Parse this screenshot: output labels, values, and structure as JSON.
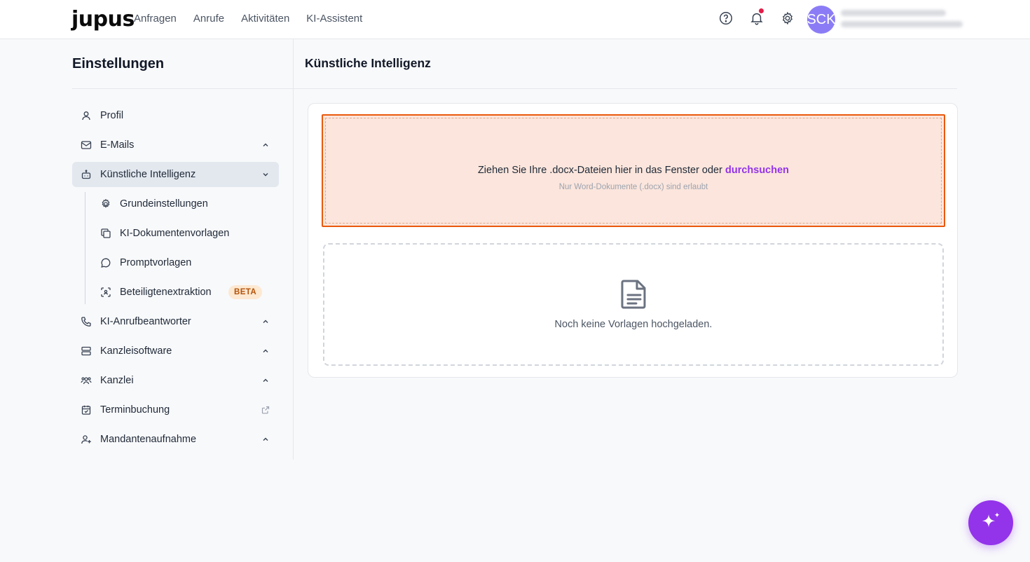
{
  "header": {
    "logo": "jupus",
    "nav": [
      "Anfragen",
      "Anrufe",
      "Aktivitäten",
      "KI-Assistent"
    ],
    "avatar_initials": "SCK"
  },
  "sidebar": {
    "title": "Einstellungen",
    "items": [
      {
        "label": "Profil",
        "icon": "user-icon"
      },
      {
        "label": "E-Mails",
        "icon": "mail-icon"
      },
      {
        "label": "Künstliche Intelligenz",
        "icon": "bot-icon",
        "active": true
      },
      {
        "label": "KI-Anrufbeantworter",
        "icon": "phone-icon"
      },
      {
        "label": "Kanzleisoftware",
        "icon": "server-icon"
      },
      {
        "label": "Kanzlei",
        "icon": "users-icon"
      },
      {
        "label": "Terminbuchung",
        "icon": "calendar-check-icon"
      },
      {
        "label": "Mandantenaufnahme",
        "icon": "user-plus-icon"
      }
    ],
    "subitems": [
      {
        "label": "Grundeinstellungen",
        "icon": "gear-icon"
      },
      {
        "label": "KI-Dokumentenvorlagen",
        "icon": "copy-icon"
      },
      {
        "label": "Promptvorlagen",
        "icon": "chat-icon"
      },
      {
        "label": "Beteiligtenextraktion",
        "icon": "scan-user-icon",
        "badge": "BETA"
      }
    ]
  },
  "main": {
    "title": "Künstliche Intelligenz",
    "dropzone": {
      "text": "Ziehen Sie Ihre .docx-Dateien hier in das Fenster oder ",
      "link": "durchsuchen",
      "hint": "Nur Word-Dokumente (.docx) sind erlaubt"
    },
    "empty_text": "Noch keine Vorlagen hochgeladen."
  },
  "colors": {
    "accent": "#9333ea",
    "dropzone_border": "#ea580c",
    "dropzone_bg": "#fbe5dc",
    "avatar": "#8b7cf6"
  }
}
